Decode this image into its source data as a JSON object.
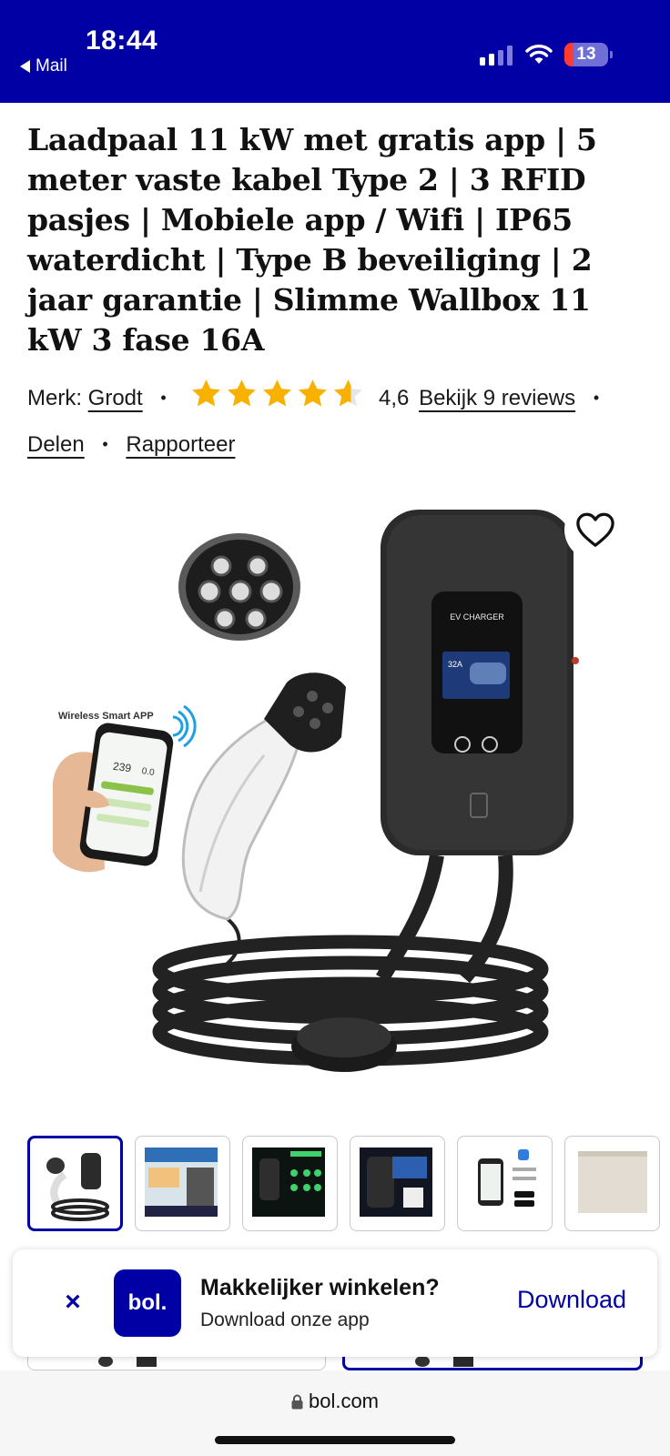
{
  "status_bar": {
    "time": "18:44",
    "back_label": "Mail",
    "battery": "13"
  },
  "product": {
    "title": "Laadpaal 11 kW met gratis app | 5 meter vaste kabel Type 2 | 3 RFID pasjes | Mobiele app / Wifi | IP65 waterdicht | Type B beveiliging | 2 jaar garantie | Slimme Wallbox 11 kW 3 fase 16A",
    "brand_label": "Merk:",
    "brand": "Grodt",
    "rating": "4,6",
    "reviews_link": "Bekijk 9 reviews",
    "share_link": "Delen",
    "report_link": "Rapporteer"
  },
  "image_text": {
    "screen_label": "EV CHARGER",
    "amp_label": "32A",
    "app_label": "Wireless Smart APP",
    "phone_v1": "239",
    "phone_v2": "0.0"
  },
  "icons": [
    "heart-icon",
    "star-icon",
    "close-icon",
    "lock-icon",
    "wifi-icon",
    "signal-icon",
    "battery-icon"
  ],
  "app_banner": {
    "close": "×",
    "logo": "bol.",
    "title": "Makkelijker winkelen?",
    "subtitle": "Download onze app",
    "download": "Download"
  },
  "browser": {
    "url": "bol.com"
  },
  "colors": {
    "brand_blue": "#0000a4",
    "star": "#f9b100",
    "battery_red": "#ff3b30"
  }
}
